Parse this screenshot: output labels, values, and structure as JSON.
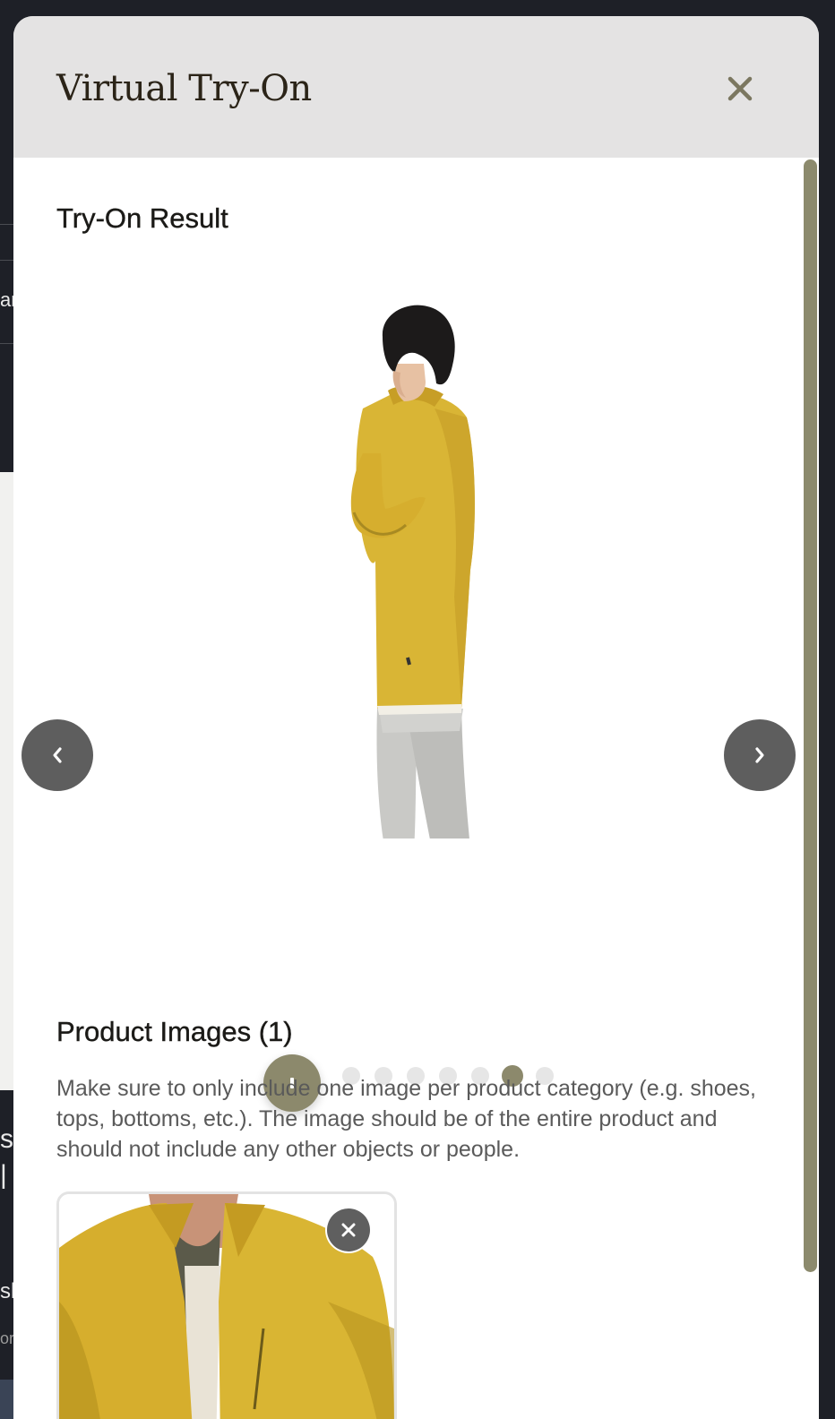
{
  "modal": {
    "title": "Virtual Try-On",
    "close_icon": "close-icon"
  },
  "result": {
    "heading": "Try-On Result",
    "prev_icon": "chevron-left-icon",
    "next_icon": "chevron-right-icon",
    "pause_icon": "pause-icon",
    "slide_count": 7,
    "active_slide": 6
  },
  "products": {
    "heading": "Product Images (1)",
    "helper_text": "Make sure to only include one image per product category (e.g. shoes, tops, bottoms, etc.). The image should be of the entire product and should not include any other objects or people.",
    "remove_icon": "close-icon"
  },
  "colors": {
    "accent": "#8c896c",
    "header_bg": "#e4e3e3",
    "nav_button": "#5e5e5e",
    "jacket_yellow": "#d9b535"
  },
  "background": {
    "fragments": [
      "ar",
      "s",
      "|",
      "sl",
      "or"
    ]
  }
}
